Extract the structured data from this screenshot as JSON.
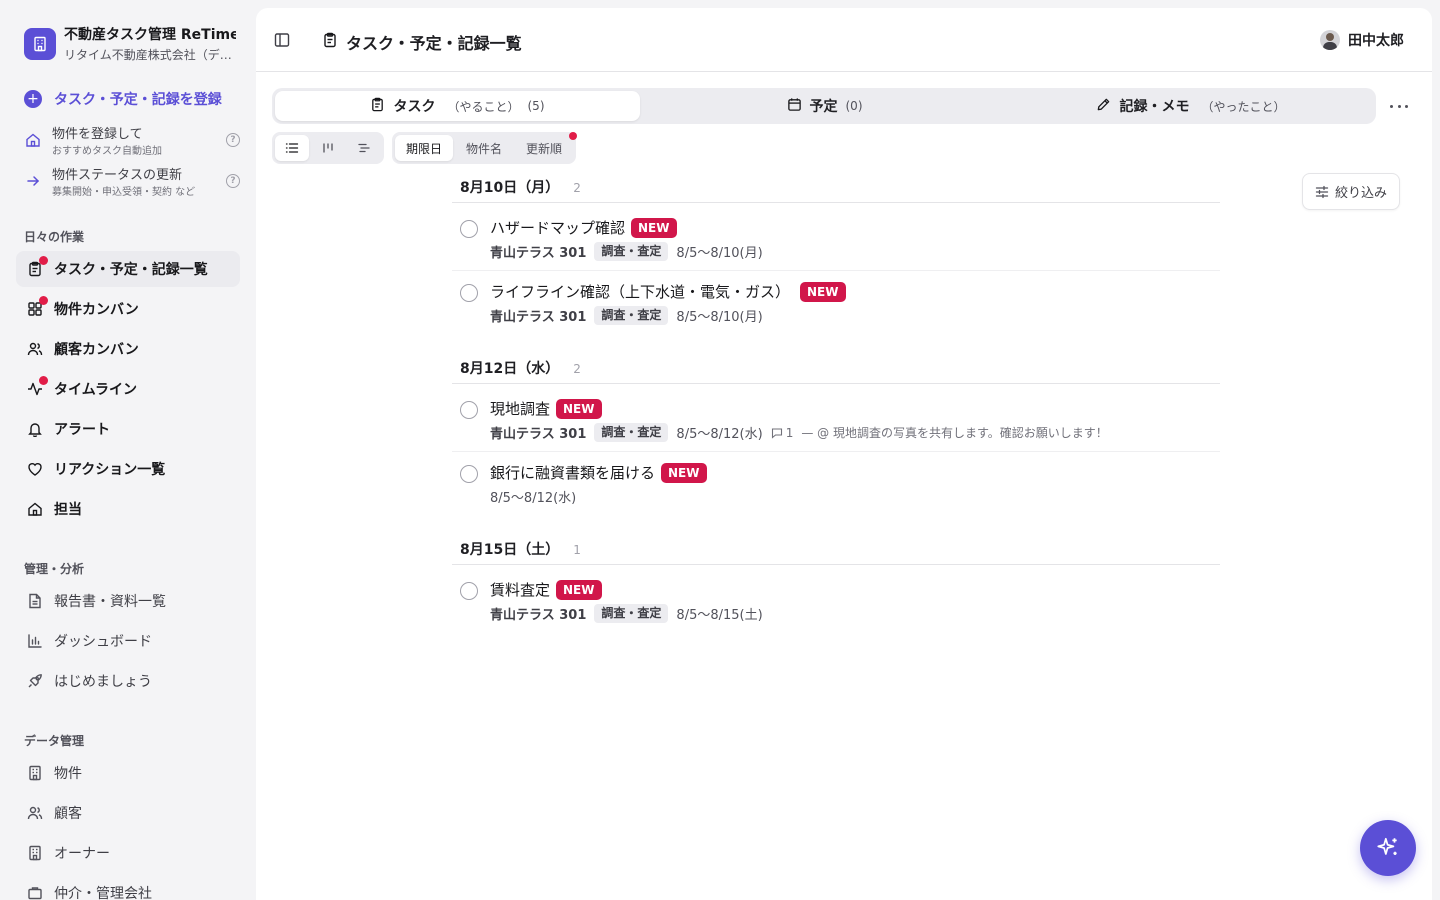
{
  "colors": {
    "accent": "#5b4fd6",
    "new_badge": "#d1164a",
    "notify_dot": "#e11d48"
  },
  "brand": {
    "name": "不動産タスク管理 ReTime",
    "company": "リタイム不動産株式会社（デモ）"
  },
  "quick": {
    "register": "タスク・予定・記録を登録",
    "add_property_title": "物件を登録して",
    "add_property_sub": "おすすめタスク自動追加",
    "status_update_title": "物件ステータスの更新",
    "status_update_sub": "募集開始・申込受領・契約 など",
    "help": "?"
  },
  "sections": {
    "daily": "日々の作業",
    "management": "管理・分析",
    "data": "データ管理"
  },
  "nav": {
    "tasks": "タスク・予定・記録一覧",
    "property_kanban": "物件カンバン",
    "customer_kanban": "顧客カンバン",
    "timeline": "タイムライン",
    "alerts": "アラート",
    "reactions": "リアクション一覧",
    "assigned": "担当",
    "reports": "報告書・資料一覧",
    "dashboard": "ダッシュボード",
    "getting_started": "はじめましょう",
    "properties": "物件",
    "customers": "顧客",
    "owners": "オーナー",
    "companies": "仲介・管理会社"
  },
  "header": {
    "title": "タスク・予定・記録一覧",
    "user": "田中太郎"
  },
  "tabs": {
    "task_label": "タスク",
    "task_sub": "（やること）",
    "task_count": "(5)",
    "schedule_label": "予定",
    "schedule_count": "(0)",
    "record_label": "記録・メモ",
    "record_sub": "（やったこと）"
  },
  "sort": {
    "due": "期限日",
    "property": "物件名",
    "updated": "更新順"
  },
  "filter": {
    "label": "絞り込み"
  },
  "badge": "NEW",
  "groups": [
    {
      "date": "8月10日（月）",
      "count": "2",
      "tasks": [
        {
          "title": "ハザードマップ確認",
          "property": "青山テラス 301",
          "category": "調査・査定",
          "period": "8/5〜8/10(月)"
        },
        {
          "title": "ライフライン確認（上下水道・電気・ガス）",
          "property": "青山テラス 301",
          "category": "調査・査定",
          "period": "8/5〜8/10(月)"
        }
      ]
    },
    {
      "date": "8月12日（水）",
      "count": "2",
      "tasks": [
        {
          "title": "現地調査",
          "property": "青山テラス 301",
          "category": "調査・査定",
          "period": "8/5〜8/12(水)",
          "comments": "1",
          "comment_text": "— @ 現地調査の写真を共有します。確認お願いします！"
        },
        {
          "title": "銀行に融資書類を届ける",
          "period": "8/5〜8/12(水)"
        }
      ]
    },
    {
      "date": "8月15日（土）",
      "count": "1",
      "tasks": [
        {
          "title": "賃料査定",
          "property": "青山テラス 301",
          "category": "調査・査定",
          "period": "8/5〜8/15(土)"
        }
      ]
    }
  ]
}
